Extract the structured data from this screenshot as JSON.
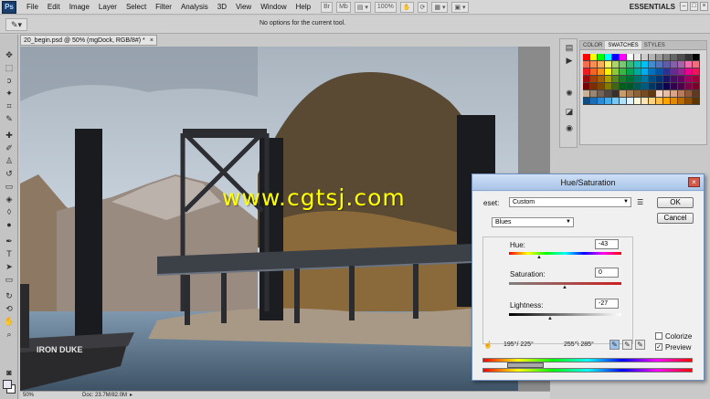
{
  "app": {
    "logo": "Ps",
    "menu": [
      "File",
      "Edit",
      "Image",
      "Layer",
      "Select",
      "Filter",
      "Analysis",
      "3D",
      "View",
      "Window",
      "Help"
    ],
    "zoom_combo": "100%",
    "workspace": "ESSENTIALS"
  },
  "options_bar": {
    "message": "No options for the current tool."
  },
  "document": {
    "tab_title": "20_begin.psd @ 50% (mgDock, RGB/8#) *",
    "boat_name": "IRON DUKE"
  },
  "status": {
    "zoom": "50%",
    "doc_size": "Doc: 23.7M/82.0M"
  },
  "swatches_panel": {
    "tabs": [
      "COLOR",
      "SWATCHES",
      "STYLES"
    ],
    "active_tab": "SWATCHES",
    "colors": [
      "#ff0000",
      "#ffff00",
      "#00ff00",
      "#00ffff",
      "#0000ff",
      "#ff00ff",
      "#ffffff",
      "#e6e6e6",
      "#cccccc",
      "#b3b3b3",
      "#999999",
      "#808080",
      "#666666",
      "#4d4d4d",
      "#333333",
      "#000000",
      "#f26c4f",
      "#f68e55",
      "#fbaf5c",
      "#fff467",
      "#acd372",
      "#7cc576",
      "#3bb878",
      "#1abbb4",
      "#00bff3",
      "#438ccb",
      "#5574b9",
      "#605ca8",
      "#855fa8",
      "#a763a8",
      "#f06ea9",
      "#f26d7d",
      "#ed1c24",
      "#f26522",
      "#f7941d",
      "#fff200",
      "#8dc63f",
      "#39b54a",
      "#00a651",
      "#00a99d",
      "#00aeef",
      "#0072bc",
      "#0054a6",
      "#2e3192",
      "#662d91",
      "#92278f",
      "#ec008c",
      "#ed145b",
      "#9e0b0f",
      "#a0410d",
      "#a36209",
      "#aba000",
      "#598527",
      "#1a7b30",
      "#007236",
      "#00746b",
      "#0076a3",
      "#004b80",
      "#003471",
      "#1b1464",
      "#440e62",
      "#630460",
      "#9e005d",
      "#9e0039",
      "#790000",
      "#7b2e00",
      "#7d4900",
      "#827b00",
      "#406618",
      "#005e20",
      "#005826",
      "#005952",
      "#005b7f",
      "#003663",
      "#002157",
      "#0d004c",
      "#32004b",
      "#4b0049",
      "#7b0046",
      "#7a0026",
      "#c7b299",
      "#998675",
      "#736357",
      "#534741",
      "#37302d",
      "#c69c6d",
      "#a67c52",
      "#8c6239",
      "#754c24",
      "#603913",
      "#f5d6c6",
      "#e6bda6",
      "#d9a58a",
      "#b87c5c",
      "#8f5a3c",
      "#5e3a25",
      "#0f4c81",
      "#1c6db5",
      "#2b8ad6",
      "#46a9e8",
      "#7cc7f2",
      "#b3e0f9",
      "#e0f2fd",
      "#fff8dc",
      "#ffe4b5",
      "#ffd27f",
      "#ffbf47",
      "#ffa500",
      "#e08a00",
      "#b86b00",
      "#8a5000",
      "#5c3500"
    ]
  },
  "hue_saturation": {
    "title": "Hue/Saturation",
    "preset_label": "eset:",
    "preset_value": "Custom",
    "channel": "Blues",
    "hue_label": "Hue:",
    "hue_value": "-43",
    "saturation_label": "Saturation:",
    "saturation_value": "0",
    "lightness_label": "Lightness:",
    "lightness_value": "-27",
    "ok_label": "OK",
    "cancel_label": "Cancel",
    "colorize_label": "Colorize",
    "preview_label": "Preview",
    "colorize_checked": false,
    "preview_checked": true,
    "range_left": "195°/ 225°",
    "range_right": "255°\\ 285°"
  },
  "watermark": "www.cgtsj.com"
}
